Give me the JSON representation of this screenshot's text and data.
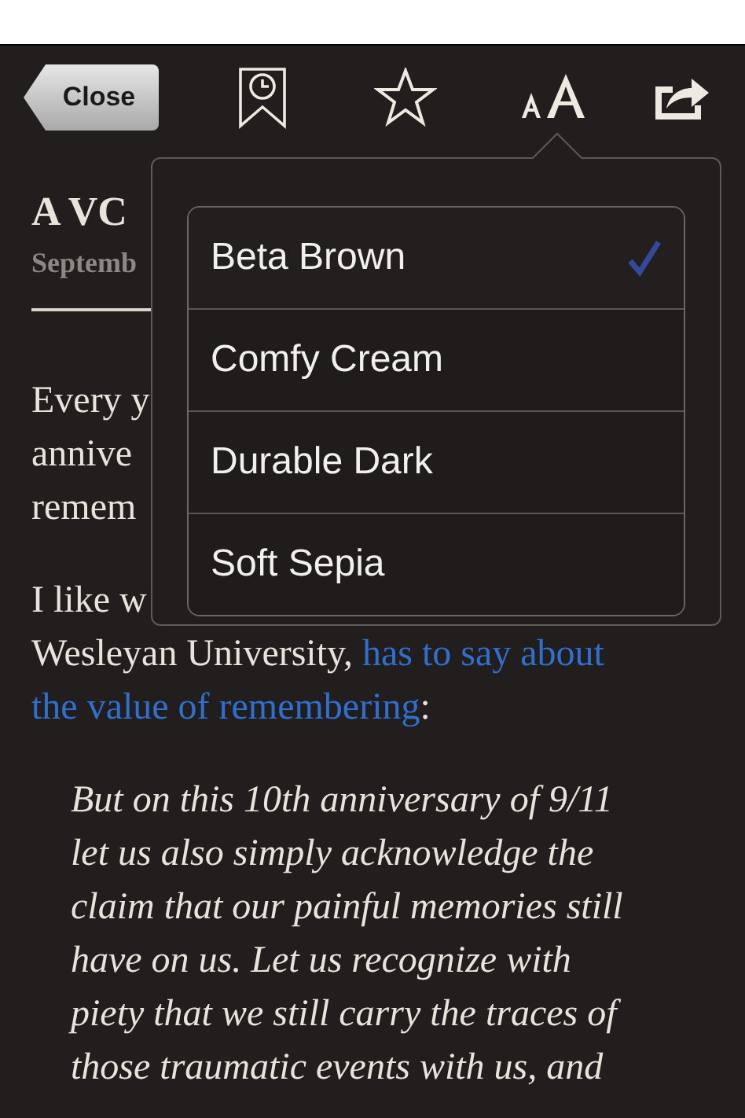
{
  "toolbar": {
    "close_button": "Close"
  },
  "theme_menu": {
    "items": [
      {
        "label": "Beta Brown",
        "selected": true
      },
      {
        "label": "Comfy Cream",
        "selected": false
      },
      {
        "label": "Durable Dark",
        "selected": false
      },
      {
        "label": "Soft Sepia",
        "selected": false
      }
    ]
  },
  "article": {
    "title": "A VC",
    "date": "Septemb",
    "paragraphs": [
      [
        [
          {
            "kind": "plain",
            "text": "Every y"
          }
        ],
        [
          {
            "kind": "plain",
            "text": "annive"
          }
        ],
        [
          {
            "kind": "plain",
            "text": "remem"
          }
        ]
      ],
      [
        [
          {
            "kind": "plain",
            "text": "I like w"
          }
        ],
        [
          {
            "kind": "plain",
            "text": "Wesleyan University,"
          },
          {
            "kind": "link",
            "text": "has to say about"
          }
        ],
        [
          {
            "kind": "link",
            "text": "the value of remembering"
          },
          {
            "kind": "plain",
            "text": ":"
          }
        ]
      ]
    ],
    "quote": [
      "But on this 10th anniversary of 9/11",
      "let us also simply acknowledge the",
      "claim that our painful memories still",
      "have on us. Let us recognize with",
      "piety that we still carry the traces of",
      "those traumatic events with us, and"
    ]
  }
}
